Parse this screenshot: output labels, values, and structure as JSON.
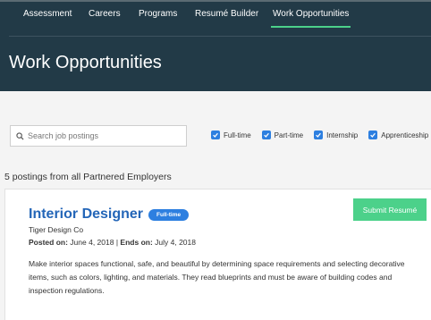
{
  "nav": {
    "tabs": [
      {
        "label": "Assessment",
        "active": false
      },
      {
        "label": "Careers",
        "active": false
      },
      {
        "label": "Programs",
        "active": false
      },
      {
        "label": "Resumé Builder",
        "active": false
      },
      {
        "label": "Work Opportunities",
        "active": true
      }
    ]
  },
  "page": {
    "title": "Work Opportunities"
  },
  "search": {
    "icon": "search-icon",
    "placeholder": "Search job postings",
    "value": ""
  },
  "filters": [
    {
      "label": "Full-time",
      "checked": true
    },
    {
      "label": "Part-time",
      "checked": true
    },
    {
      "label": "Internship",
      "checked": true
    },
    {
      "label": "Apprenticeship",
      "checked": true
    }
  ],
  "results": {
    "summary": "5 postings from all Partnered Employers"
  },
  "posting": {
    "title": "Interior Designer",
    "type_badge": "Full-time",
    "company": "Tiger Design Co",
    "posted_label": "Posted on:",
    "posted_date": "June 4, 2018",
    "separator": "|",
    "ends_label": "Ends on:",
    "ends_date": "July 4, 2018",
    "submit_label": "Submit Resumé",
    "description": "Make interior spaces functional, safe, and beautiful by determining space requirements and selecting decorative items, such as colors, lighting, and materials. They read blueprints and must be aware of building codes and inspection regulations."
  },
  "colors": {
    "header_bg": "#223a47",
    "accent_green": "#4cd18a",
    "link_blue": "#2466b8",
    "checkbox_blue": "#2d7fe0",
    "page_bg": "#f4f4f4"
  }
}
